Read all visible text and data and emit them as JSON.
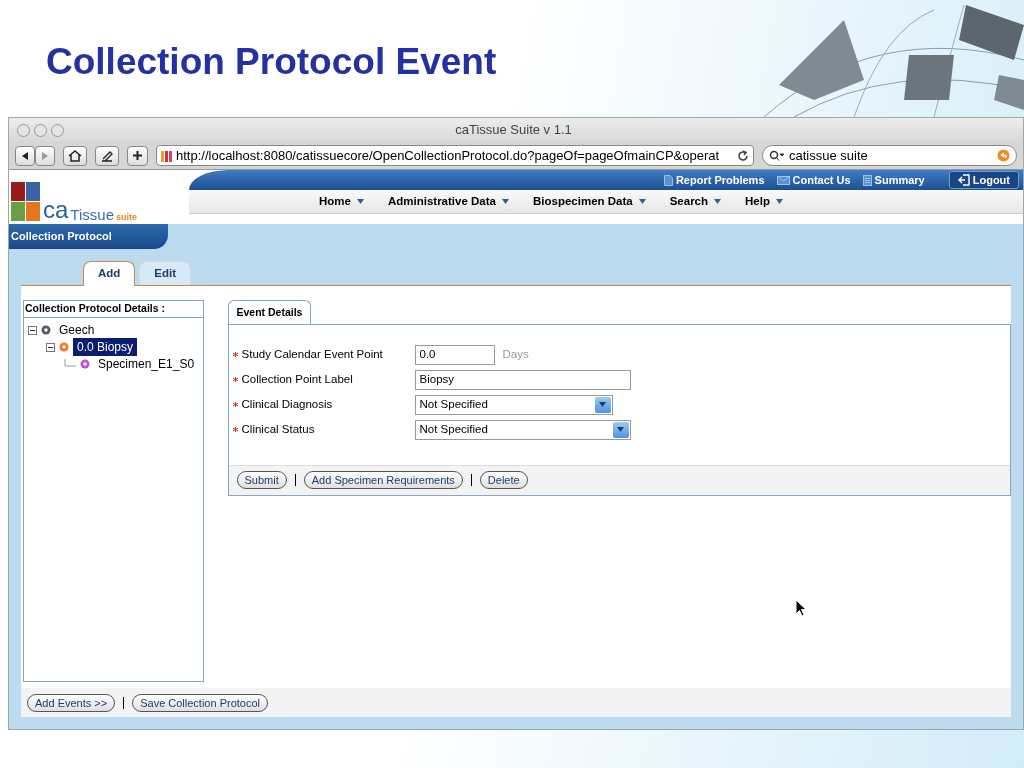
{
  "slide": {
    "title": "Collection Protocol Event"
  },
  "browser": {
    "title": "caTissue Suite v 1.1",
    "url": "http://localhost:8080/catissuecore/OpenCollectionProtocol.do?pageOf=pageOfmainCP&operat",
    "search": "catissue suite"
  },
  "app": {
    "logo": {
      "prefix": "ca",
      "name": "Tissue",
      "suffix": "suite"
    },
    "top_links": [
      "Report Problems",
      "Contact Us",
      "Summary"
    ],
    "logout": "Logout",
    "menu": [
      "Home",
      "Administrative Data",
      "Biospecimen Data",
      "Search",
      "Help"
    ],
    "section_title": "Collection Protocol",
    "tabs": [
      {
        "label": "Add",
        "selected": true
      },
      {
        "label": "Edit",
        "selected": false
      }
    ],
    "tree": {
      "title": "Collection Protocol Details :",
      "nodes": [
        {
          "label": "Geech",
          "kind": "protocol",
          "expanded": true,
          "selected": false,
          "children": [
            {
              "label": "0.0 Biopsy",
              "kind": "event",
              "expanded": true,
              "selected": true,
              "children": [
                {
                  "label": "Specimen_E1_S0",
                  "kind": "specimen",
                  "selected": false
                }
              ]
            }
          ]
        }
      ]
    },
    "event_tab": "Event Details",
    "fields": [
      {
        "label": "Study Calendar Event Point",
        "kind": "text",
        "value": "0.0",
        "unit": "Days"
      },
      {
        "label": "Collection Point Label",
        "kind": "text",
        "value": "Biopsy"
      },
      {
        "label": "Clinical Diagnosis",
        "kind": "select",
        "value": "Not Specified"
      },
      {
        "label": "Clinical Status",
        "kind": "select",
        "value": "Not Specified"
      }
    ],
    "event_buttons": [
      "Submit",
      "Add Specimen Requirements",
      "Delete"
    ],
    "footer_buttons": [
      "Add Events >>",
      "Save Collection Protocol"
    ]
  }
}
